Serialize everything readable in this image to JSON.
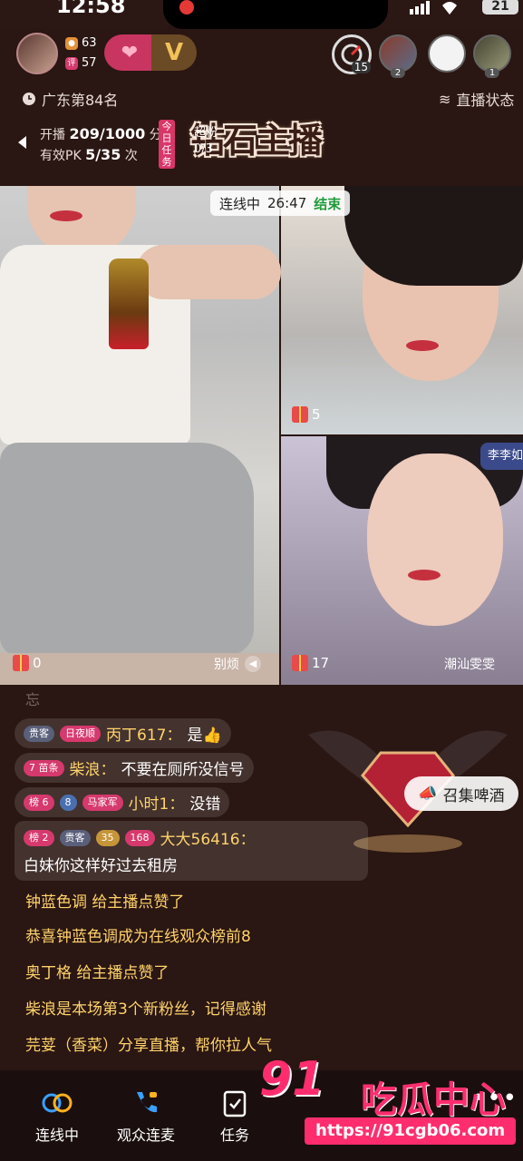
{
  "status": {
    "time": "12:58",
    "battery": "21"
  },
  "host": {
    "followers": "63",
    "reviews": "57"
  },
  "top_viewers": [
    {
      "rank": "15"
    },
    {
      "rank": "2"
    },
    {
      "rank": ""
    },
    {
      "rank": "1"
    }
  ],
  "region_rank": "广东第84名",
  "live_status_label": "直播状态",
  "tasks": {
    "start_label": "开播",
    "start_value": "209/1000",
    "start_unit": "分钟",
    "pk_label": "有效PK",
    "pk_value": "5/35",
    "pk_unit": "次",
    "daily_tag": "今日任务",
    "fans_label": "超粉",
    "fans_value": "0/3",
    "banner_title": "钻石主播"
  },
  "pk": {
    "status": "连线中",
    "timer": "26:47",
    "end_label": "结束"
  },
  "streams": {
    "main_gifts": "0",
    "main_mute_label": "别烦",
    "right_top_gifts": "5",
    "right_bot_gifts": "17",
    "right_bot_name": "潮汕雯雯",
    "right_top_name": "李李如"
  },
  "chat": {
    "faded": "忘",
    "row1": {
      "badge1": "贵客",
      "badge2": "日夜顺",
      "user": "丙丁617：",
      "msg": "是👍"
    },
    "row2": {
      "badge1": "7 苗条",
      "user": "柴浪：",
      "msg": "不要在厕所没信号"
    },
    "row3": {
      "badge1": "榜 6",
      "badge2": "8",
      "badge3": "马家军",
      "user": "小时1：",
      "msg": "没错"
    },
    "row4": {
      "badge1": "榜 2",
      "badge2": "贵客",
      "badge3": "35",
      "badge4": "168",
      "user": "大大56416：",
      "msg": "白妹你这样好过去租房"
    },
    "sys1": "钟蓝色调 给主播点赞了",
    "sys2": "恭喜钟蓝色调成为在线观众榜前8",
    "sys3": "奥丁格 给主播点赞了",
    "sys4": "柴浪是本场第3个新粉丝，记得感谢",
    "sys5": "芫荽（香菜）分享直播，帮你拉人气"
  },
  "promo": {
    "beer_label": "召集啤酒"
  },
  "nav": {
    "link_label": "连线中",
    "viewer_link_label": "观众连麦",
    "task_label": "任务",
    "more_label": "多"
  },
  "watermark": {
    "logo": "91",
    "brand": "吃瓜中心",
    "url": "https://91cgb06.com"
  },
  "colors": {
    "accent": "#ff2d6e",
    "gold": "#ffd36b",
    "bg": "#2a1612"
  }
}
